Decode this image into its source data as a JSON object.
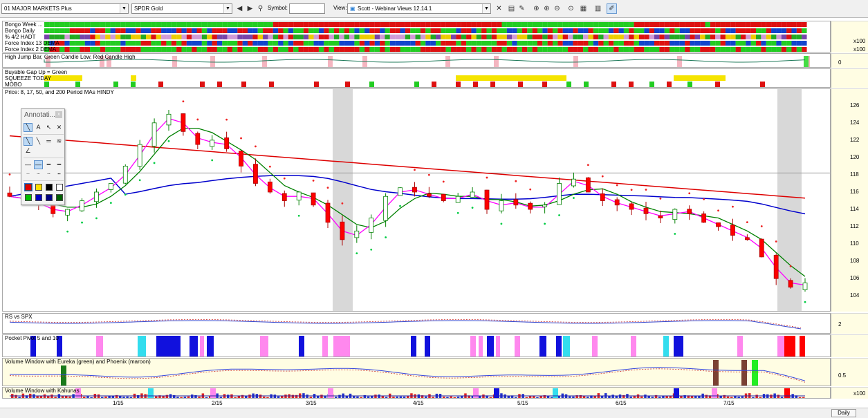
{
  "toolbar": {
    "watchlist": "01 MAJOR MARKETS Plus",
    "instrument": "SPDR Gold",
    "symbol_label": "Symbol:",
    "symbol_value": "",
    "view_label": "View:",
    "view_value": "Scott - Webinar Views 12.14.1"
  },
  "panes": {
    "strip1": "Bongo Week ...",
    "strip2": "Bongo Daily",
    "strip3": "% 4/2 HADT",
    "strip4": "Force Index 13 DEMA",
    "strip5": "Force Index 2 DEMA",
    "highjump": "High Jump Bar, Green Candle Low, Red Candle High",
    "buyable": "Buyable Gap Up = Green",
    "squeeze": "SQUEEZE TODAY",
    "mobo": "MOBO",
    "price": "Price: 8, 17, 50, and 200 Period MAs HINDY",
    "rs": "RS vs SPX",
    "pocket": "Pocket Pivot 5 and 10",
    "volwin1": "Volume Window with Eureka (green) and Phoenix (maroon)",
    "volwin2": "Volume Window with Kahunas"
  },
  "axis": {
    "strip4": "x100",
    "strip5": "x100",
    "highjump": "0",
    "rs": "2",
    "volwin1": "0.5",
    "volwin2": "x100",
    "price_ticks": [
      "126",
      "124",
      "122",
      "120",
      "118",
      "116",
      "114",
      "112",
      "110",
      "108",
      "106",
      "104"
    ]
  },
  "annotation": {
    "title": "Annotati..."
  },
  "dates": [
    "1/15",
    "2/15",
    "3/15",
    "4/15",
    "5/15",
    "6/15",
    "7/15"
  ],
  "status": {
    "period": "Daily"
  },
  "colors": {
    "up": "#ffffff",
    "down": "#ff0000",
    "ma8": "#ff00ff",
    "ma17": "#008000",
    "ma50": "#0000cc",
    "ma200": "#dd0000",
    "dots": "#00cc44"
  },
  "chart_data": {
    "type": "candlestick",
    "title": "Price: 8, 17, 50, and 200 Period MAs HINDY",
    "ylim": [
      102.5,
      127.5
    ],
    "y_ticks": [
      104,
      106,
      108,
      110,
      112,
      114,
      116,
      118,
      120,
      122,
      124,
      126
    ],
    "x_labels": [
      "1/15",
      "2/15",
      "3/15",
      "4/15",
      "5/15",
      "6/15",
      "7/15"
    ],
    "approx_close_series": [
      115.5,
      115.0,
      114.5,
      113.5,
      114.0,
      115.0,
      116.0,
      117.0,
      119.0,
      121.5,
      124.0,
      125.0,
      123.0,
      121.5,
      122.0,
      121.0,
      119.0,
      117.0,
      116.0,
      115.0,
      116.0,
      114.5,
      112.5,
      110.5,
      111.5,
      113.0,
      115.5,
      116.5,
      116.0,
      115.5,
      115.0,
      115.5,
      116.0,
      114.0,
      115.0,
      114.5,
      114.0,
      114.5,
      117.0,
      117.5,
      116.0,
      115.0,
      114.5,
      114.0,
      113.5,
      113.0,
      114.0,
      113.5,
      112.5,
      112.0,
      111.0,
      110.5,
      108.5,
      106.0,
      105.0,
      105.5
    ]
  }
}
